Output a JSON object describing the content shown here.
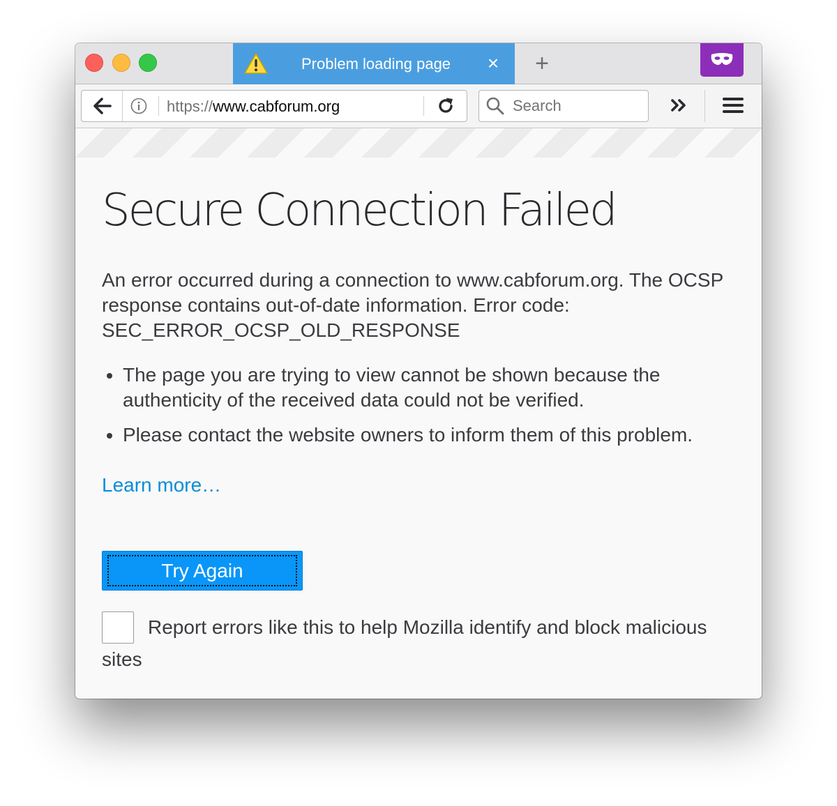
{
  "tab": {
    "title": "Problem loading page",
    "close_symbol": "×",
    "new_tab_symbol": "+"
  },
  "navbar": {
    "url_scheme": "https://",
    "url_host": "www.cabforum.org",
    "search_placeholder": "Search"
  },
  "icons": [
    "warning-icon",
    "close-icon",
    "plus-icon",
    "private-mask-icon",
    "back-arrow-icon",
    "info-icon",
    "reload-icon",
    "search-icon",
    "overflow-chevron-icon",
    "hamburger-menu-icon"
  ],
  "colors": {
    "tab_active": "#4a9ee0",
    "private_badge": "#8c2eb9",
    "button_primary": "#0996f8",
    "link": "#0a8dd7"
  },
  "error": {
    "title": "Secure Connection Failed",
    "description": "An error occurred during a connection to www.cabforum.org. The OCSP response contains out-of-date information. Error code: SEC_ERROR_OCSP_OLD_RESPONSE",
    "reasons": [
      "The page you are trying to view cannot be shown because the authenticity of the received data could not be verified.",
      "Please contact the website owners to inform them of this problem."
    ],
    "learn_more": "Learn more…",
    "try_again": "Try Again",
    "report_label": "Report errors like this to help Mozilla identify and block malicious sites",
    "report_checked": false
  }
}
